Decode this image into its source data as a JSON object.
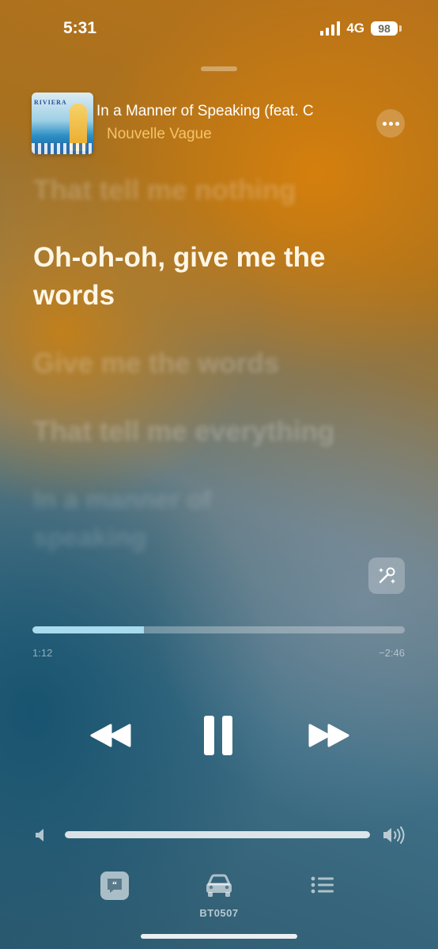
{
  "status_bar": {
    "time": "5:31",
    "network": "4G",
    "battery": "98"
  },
  "now_playing": {
    "title": "In a Manner of Speaking (feat. C",
    "artist": "Nouvelle Vague",
    "artwork_text": "RIVIERA",
    "more_icon": "ellipsis-icon"
  },
  "lyrics": {
    "previous_line": "That tell me nothing",
    "current_line": "Oh-oh-oh, give me the words",
    "next_lines": [
      "Give me the words",
      "That tell me everything",
      "In a manner of speaking"
    ]
  },
  "playback": {
    "elapsed": "1:12",
    "remaining": "−2:46",
    "progress_fraction": 0.3,
    "volume_fraction": 1.0
  },
  "controls": {
    "rewind_icon": "rewind-icon",
    "pause_icon": "pause-icon",
    "forward_icon": "fast-forward-icon"
  },
  "bottom_bar": {
    "airplay_label": "BT0507",
    "lyrics_icon": "lyrics-icon",
    "airplay_icon": "car-icon",
    "queue_icon": "list-icon"
  },
  "colors": {
    "artist": "#f6c36a",
    "progress_fill": "#a8dbee"
  }
}
